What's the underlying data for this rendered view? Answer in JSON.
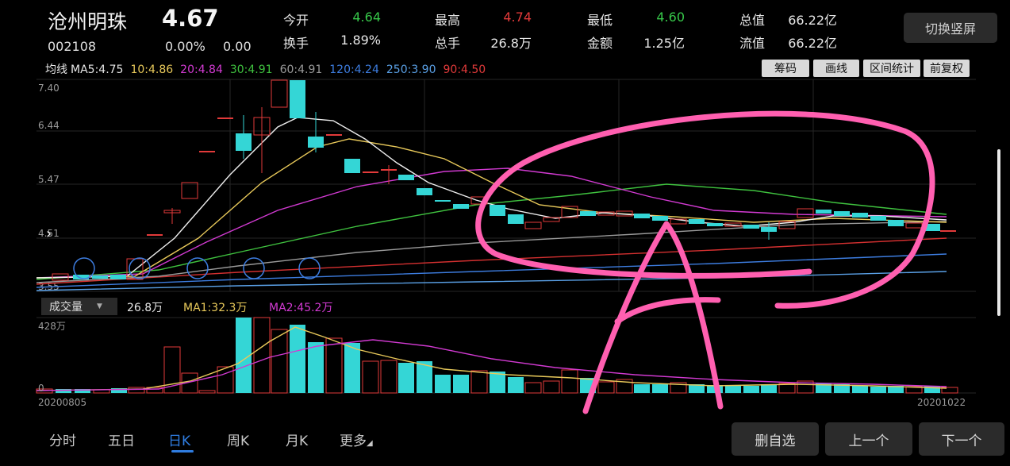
{
  "header": {
    "name": "沧州明珠",
    "price": "4.67",
    "code": "002108",
    "change_pct": "0.00%",
    "change_amt": "0.00",
    "rotate_button": "切换竖屏"
  },
  "quotes": [
    {
      "label": "今开",
      "value": "4.64",
      "color": "green"
    },
    {
      "label": "换手",
      "value": "1.89%",
      "color": "white"
    },
    {
      "label": "最高",
      "value": "4.74",
      "color": "red"
    },
    {
      "label": "总手",
      "value": "26.8万",
      "color": "white"
    },
    {
      "label": "最低",
      "value": "4.60",
      "color": "green"
    },
    {
      "label": "金额",
      "value": "1.25亿",
      "color": "white"
    },
    {
      "label": "总值",
      "value": "66.22亿",
      "color": "white"
    },
    {
      "label": "流值",
      "value": "66.22亿",
      "color": "white"
    }
  ],
  "ma_bar": {
    "title": "均线",
    "items": [
      {
        "text": "MA5:4.75",
        "color": "#e6e6e6"
      },
      {
        "text": "10:4.86",
        "color": "#e8c95a"
      },
      {
        "text": "20:4.84",
        "color": "#d23ad2"
      },
      {
        "text": "30:4.91",
        "color": "#3fc23f"
      },
      {
        "text": "60:4.91",
        "color": "#9a9a9a"
      },
      {
        "text": "120:4.24",
        "color": "#3d7de0"
      },
      {
        "text": "250:3.90",
        "color": "#5aa0e6"
      },
      {
        "text": "90:4.50",
        "color": "#e23a3a"
      }
    ]
  },
  "tools": {
    "chips": "筹码",
    "draw": "画线",
    "range": "区间统计",
    "adjust": "前复权"
  },
  "price_axis": [
    "7.40",
    "6.44",
    "5.47",
    "4.51",
    "3.55"
  ],
  "volume": {
    "indicator": "成交量",
    "current": "26.8万",
    "ma1": "MA1:32.3万",
    "ma2": "MA2:45.2万",
    "axis_top": "428万",
    "axis_bottom": "0"
  },
  "dates": {
    "start": "20200805",
    "end": "20201022"
  },
  "tabs": [
    {
      "label": "分时"
    },
    {
      "label": "五日"
    },
    {
      "label": "日K"
    },
    {
      "label": "周K"
    },
    {
      "label": "月K"
    },
    {
      "label": "更多"
    }
  ],
  "buttons": {
    "remove": "删自选",
    "prev": "上一个",
    "next": "下一个"
  },
  "colors": {
    "up": "#e23a3a",
    "down": "#34d6d6",
    "annotation": "#ff5fb0"
  },
  "chart_data": {
    "type": "candlestick",
    "price_range": [
      3.55,
      7.4
    ],
    "volume_max_label": "428万"
  }
}
